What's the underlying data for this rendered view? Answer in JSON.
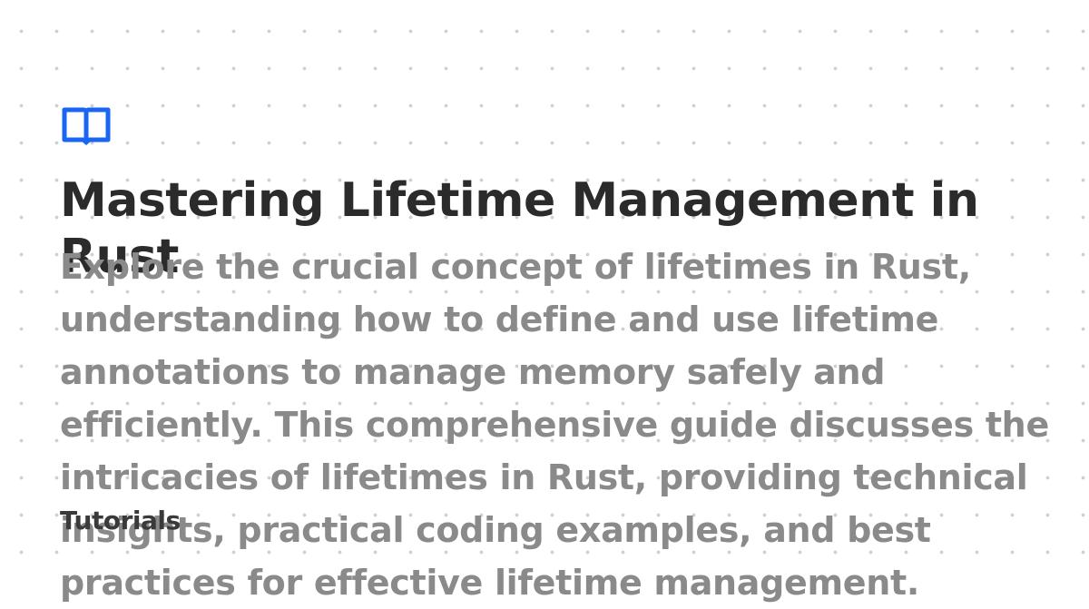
{
  "brand": {
    "logo_icon": "book-open-icon",
    "accent_color": "#1a66f2"
  },
  "post": {
    "title": "Mastering Lifetime Management in Rust",
    "description": "Explore the crucial concept of lifetimes in Rust, understanding how to define and use lifetime annotations to manage memory safely and efficiently. This comprehensive guide discusses the intricacies of lifetimes in Rust, providing technical insights, practical coding examples, and best practices for effective lifetime management.",
    "category": "Tutorials"
  },
  "colors": {
    "background": "#ffffff",
    "dot_pattern": "#cfcfcf",
    "title": "#2b2b2b",
    "description": "#8a8a8a",
    "category": "#3a3a3a"
  }
}
